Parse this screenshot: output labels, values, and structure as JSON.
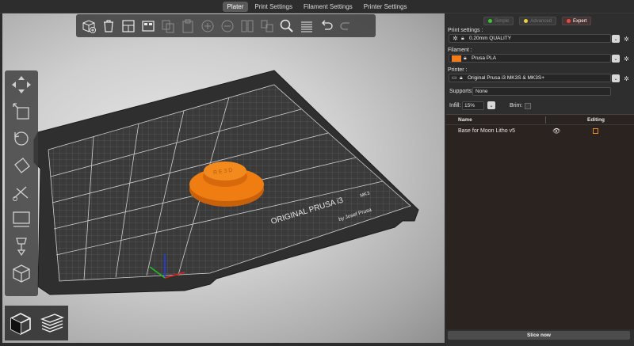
{
  "tabs": [
    "Plater",
    "Print Settings",
    "Filament Settings",
    "Printer Settings"
  ],
  "modes": {
    "simple": {
      "label": "Simple",
      "color": "#37c837"
    },
    "advanced": {
      "label": "Advanced",
      "color": "#e8d23a"
    },
    "expert": {
      "label": "Expert",
      "color": "#e84a4a"
    }
  },
  "settings": {
    "print_label": "Print settings :",
    "print_value": "0.20mm QUALITY",
    "filament_label": "Filament :",
    "filament_value": "Prusa PLA",
    "filament_color": "#f07d1b",
    "printer_label": "Printer :",
    "printer_value": "Original Prusa i3 MK3S & MK3S+",
    "supports_label": "Supports:",
    "supports_value": "None",
    "infill_label": "Infill:",
    "infill_value": "15%",
    "brim_label": "Brim:"
  },
  "object_list": {
    "col_name": "Name",
    "col_editing": "Editing",
    "items": [
      {
        "name": "Base for Moon Litho v5"
      }
    ]
  },
  "slice_label": "Slice now",
  "bed": {
    "brand_line1": "ORIGINAL PRUSA i3",
    "brand_model": "MK3",
    "brand_line2": "by Josef Prusa",
    "object_color": "#ef7d12"
  },
  "icons": {
    "top_toolbar": [
      "add-icon",
      "delete-icon",
      "delete-all-icon",
      "arrange-icon",
      "copy-icon",
      "paste-icon",
      "add-instance-icon",
      "remove-instance-icon",
      "split-objects-icon",
      "split-parts-icon",
      "search-icon",
      "layers-editing-icon",
      "undo-icon",
      "redo-icon"
    ],
    "left_toolbar": [
      "move-icon",
      "scale-icon",
      "rotate-icon",
      "place-on-face-icon",
      "cut-icon",
      "paint-supports-icon",
      "seam-painting-icon",
      "variable-layer-icon"
    ]
  }
}
